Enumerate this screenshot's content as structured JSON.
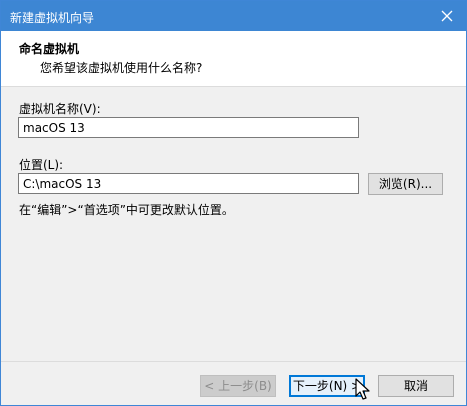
{
  "window": {
    "title": "新建虚拟机向导"
  },
  "header": {
    "title": "命名虚拟机",
    "subtitle": "您希望该虚拟机使用什么名称?"
  },
  "form": {
    "name_label": "虚拟机名称(V):",
    "name_value": "macOS 13",
    "location_label": "位置(L):",
    "location_value": "C:\\macOS 13",
    "browse_label": "浏览(R)...",
    "hint": "在“编辑”>“首选项”中可更改默认位置。"
  },
  "buttons": {
    "back": "< 上一步(B)",
    "next": "下一步(N) >",
    "cancel": "取消"
  },
  "icons": {
    "close": "close-icon",
    "cursor": "mouse-cursor-icon"
  }
}
